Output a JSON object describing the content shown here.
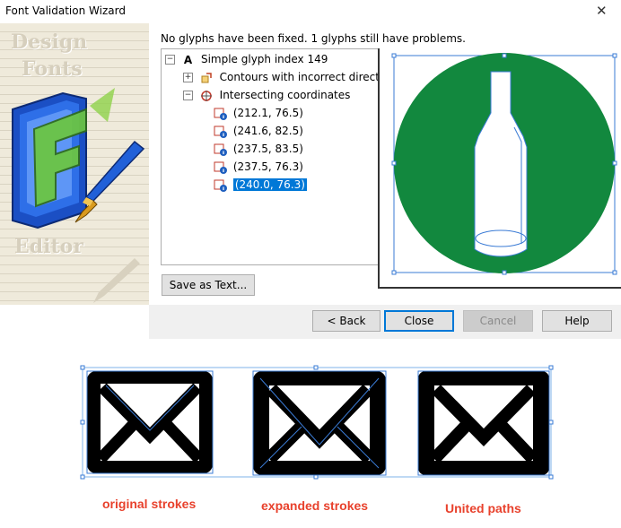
{
  "window": {
    "title": "Font Validation Wizard",
    "close_glyph": "✕"
  },
  "sidebar": {
    "logo_words": [
      "Design",
      "Fonts",
      "Editor"
    ]
  },
  "status_message": "No glyphs have been fixed. 1 glyphs still have problems.",
  "tree": {
    "root": {
      "icon": "A",
      "label": "Simple glyph index 149"
    },
    "groups": [
      {
        "label": "Contours with incorrect direction",
        "expander": "+"
      },
      {
        "label": "Intersecting coordinates",
        "expander": "−"
      }
    ],
    "points": [
      {
        "label": "(212.1, 76.5)",
        "selected": false
      },
      {
        "label": "(241.6, 82.5)",
        "selected": false
      },
      {
        "label": "(237.5, 83.5)",
        "selected": false
      },
      {
        "label": "(237.5, 76.3)",
        "selected": false
      },
      {
        "label": "(240.0, 76.3)",
        "selected": true
      }
    ]
  },
  "buttons": {
    "save_as_text": "Save as Text...",
    "back": "< Back",
    "close": "Close",
    "cancel": "Cancel",
    "help": "Help"
  },
  "colors": {
    "preview_green": "#12883e",
    "accent": "#0078d7",
    "caption_red": "#e8412c"
  },
  "captions": [
    "original strokes",
    "expanded strokes",
    "United paths"
  ]
}
